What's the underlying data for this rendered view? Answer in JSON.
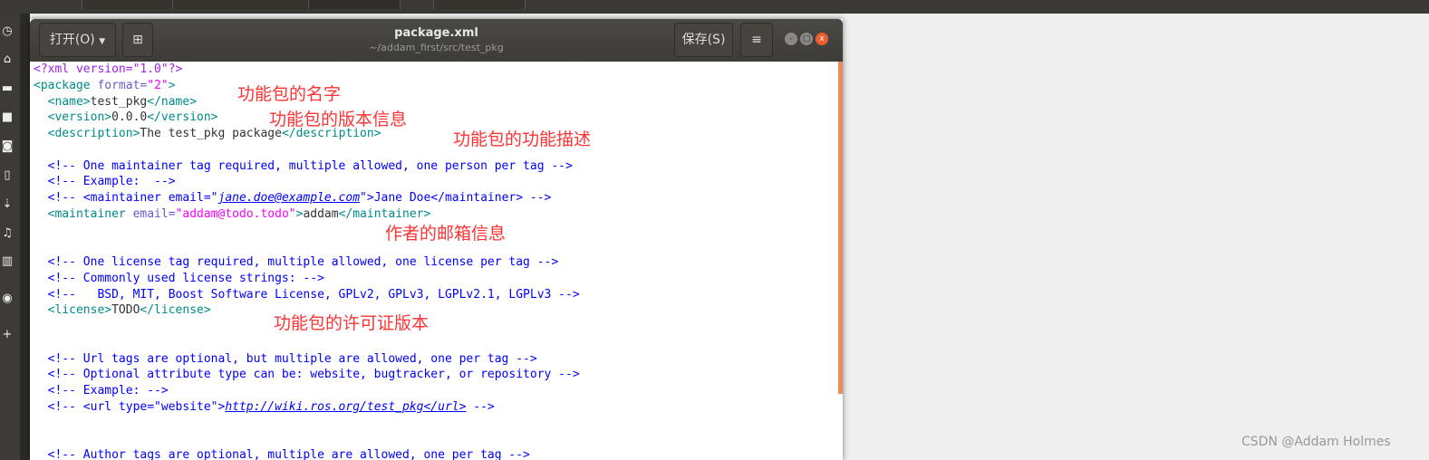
{
  "window": {
    "title": "package.xml",
    "subtitle": "~/addam_first/src/test_pkg",
    "open_label": "打开(O)",
    "save_label": "保存(S)",
    "menu_icon": "hamburger-icon",
    "new_tab_icon": "new-document-icon"
  },
  "code_lines": [
    [
      {
        "c": "decl",
        "t": "<?xml version=\"1.0\"?>"
      }
    ],
    [
      {
        "c": "tag",
        "t": "<package "
      },
      {
        "c": "attr",
        "t": "format="
      },
      {
        "c": "str",
        "t": "\"2\""
      },
      {
        "c": "tag",
        "t": ">"
      }
    ],
    [
      {
        "c": "tag",
        "t": "  <name>"
      },
      {
        "c": "txt",
        "t": "test_pkg"
      },
      {
        "c": "tag",
        "t": "</name>"
      }
    ],
    [
      {
        "c": "tag",
        "t": "  <version>"
      },
      {
        "c": "txt",
        "t": "0.0.0"
      },
      {
        "c": "tag",
        "t": "</version>"
      }
    ],
    [
      {
        "c": "tag",
        "t": "  <description>"
      },
      {
        "c": "txt",
        "t": "The test_pkg package"
      },
      {
        "c": "tag",
        "t": "</description>"
      }
    ],
    [],
    [
      {
        "c": "com",
        "t": "  <!-- One maintainer tag required, multiple allowed, one person per tag -->"
      }
    ],
    [
      {
        "c": "com",
        "t": "  <!-- Example:  -->"
      }
    ],
    [
      {
        "c": "com",
        "t": "  <!-- <maintainer email=\""
      },
      {
        "c": "link",
        "t": "jane.doe@example.com"
      },
      {
        "c": "com",
        "t": "\">Jane Doe</maintainer> -->"
      }
    ],
    [
      {
        "c": "tag",
        "t": "  <maintainer "
      },
      {
        "c": "attr",
        "t": "email="
      },
      {
        "c": "str",
        "t": "\"addam@todo.todo\""
      },
      {
        "c": "tag",
        "t": ">"
      },
      {
        "c": "txt",
        "t": "addam"
      },
      {
        "c": "tag",
        "t": "</maintainer>"
      }
    ],
    [],
    [],
    [
      {
        "c": "com",
        "t": "  <!-- One license tag required, multiple allowed, one license per tag -->"
      }
    ],
    [
      {
        "c": "com",
        "t": "  <!-- Commonly used license strings: -->"
      }
    ],
    [
      {
        "c": "com",
        "t": "  <!--   BSD, MIT, Boost Software License, GPLv2, GPLv3, LGPLv2.1, LGPLv3 -->"
      }
    ],
    [
      {
        "c": "tag",
        "t": "  <license>"
      },
      {
        "c": "txt",
        "t": "TODO"
      },
      {
        "c": "tag",
        "t": "</license>"
      }
    ],
    [],
    [],
    [
      {
        "c": "com",
        "t": "  <!-- Url tags are optional, but multiple are allowed, one per tag -->"
      }
    ],
    [
      {
        "c": "com",
        "t": "  <!-- Optional attribute type can be: website, bugtracker, or repository -->"
      }
    ],
    [
      {
        "c": "com",
        "t": "  <!-- Example: -->"
      }
    ],
    [
      {
        "c": "com",
        "t": "  <!-- <url type=\"website\">"
      },
      {
        "c": "link",
        "t": "http://wiki.ros.org/test_pkg</url>"
      },
      {
        "c": "com",
        "t": " -->"
      }
    ],
    [],
    [],
    [
      {
        "c": "com",
        "t": "  <!-- Author tags are optional, multiple are allowed, one per tag -->"
      }
    ]
  ],
  "annotations": {
    "name": "功能包的名字",
    "version": "功能包的版本信息",
    "description": "功能包的功能描述",
    "maintainer": "作者的邮箱信息",
    "license": "功能包的许可证版本"
  },
  "watermark": "CSDN @Addam Holmes"
}
